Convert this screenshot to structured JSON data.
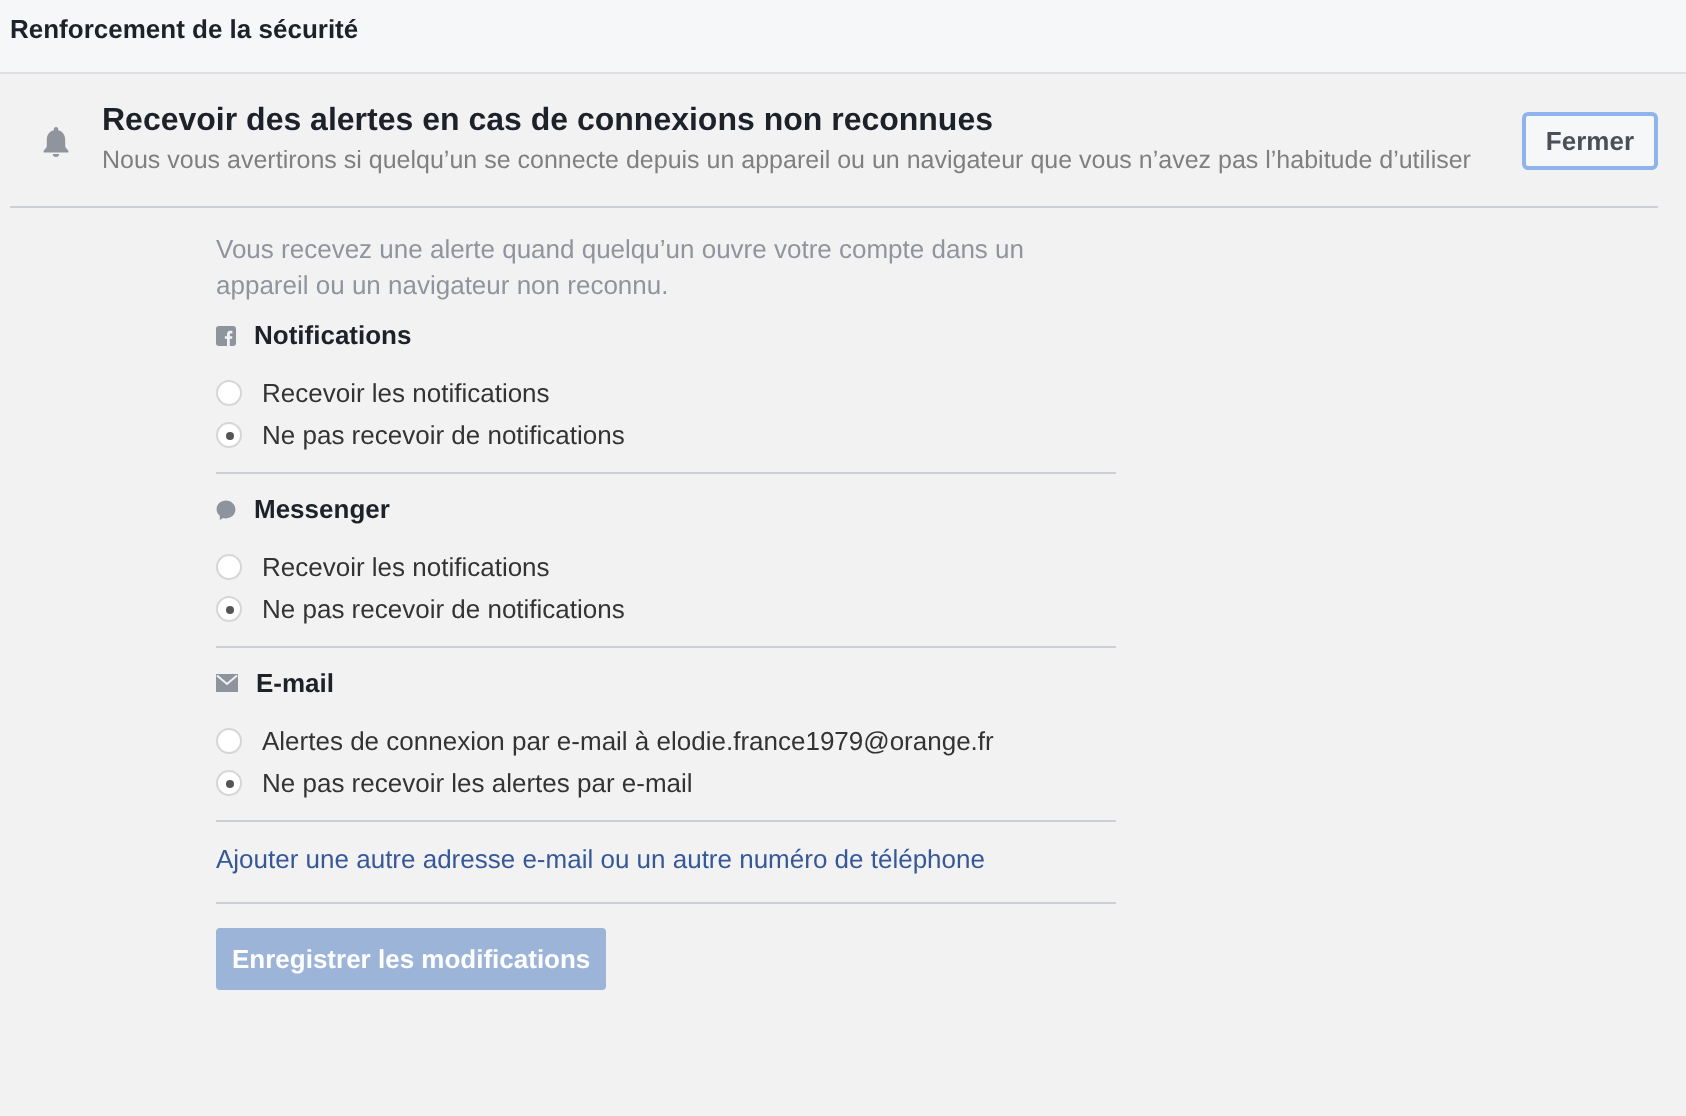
{
  "header": {
    "title": "Renforcement de la sécurité"
  },
  "alert": {
    "title": "Recevoir des alertes en cas de connexions non reconnues",
    "description": "Nous vous avertirons si quelqu’un se connecte depuis un appareil ou un navigateur que vous n’avez pas l’habitude d’utiliser",
    "close_button": "Fermer"
  },
  "intro": "Vous recevez une alerte quand quelqu’un ouvre votre compte dans un appareil ou un navigateur non reconnu.",
  "sections": [
    {
      "kind": "facebook",
      "title": "Notifications",
      "options": [
        {
          "label": "Recevoir les notifications",
          "selected": false
        },
        {
          "label": "Ne pas recevoir de notifications",
          "selected": true
        }
      ]
    },
    {
      "kind": "messenger",
      "title": "Messenger",
      "options": [
        {
          "label": "Recevoir les notifications",
          "selected": false
        },
        {
          "label": "Ne pas recevoir de notifications",
          "selected": true
        }
      ]
    },
    {
      "kind": "mail",
      "title": "E-mail",
      "options": [
        {
          "label": "Alertes de connexion par e-mail à elodie.france1979@orange.fr",
          "selected": false
        },
        {
          "label": "Ne pas recevoir les alertes par e-mail",
          "selected": true
        }
      ]
    }
  ],
  "add_contact_link": "Ajouter une autre adresse e-mail ou un autre numéro de téléphone",
  "save_button": {
    "label": "Enregistrer les modifications",
    "disabled": true
  }
}
